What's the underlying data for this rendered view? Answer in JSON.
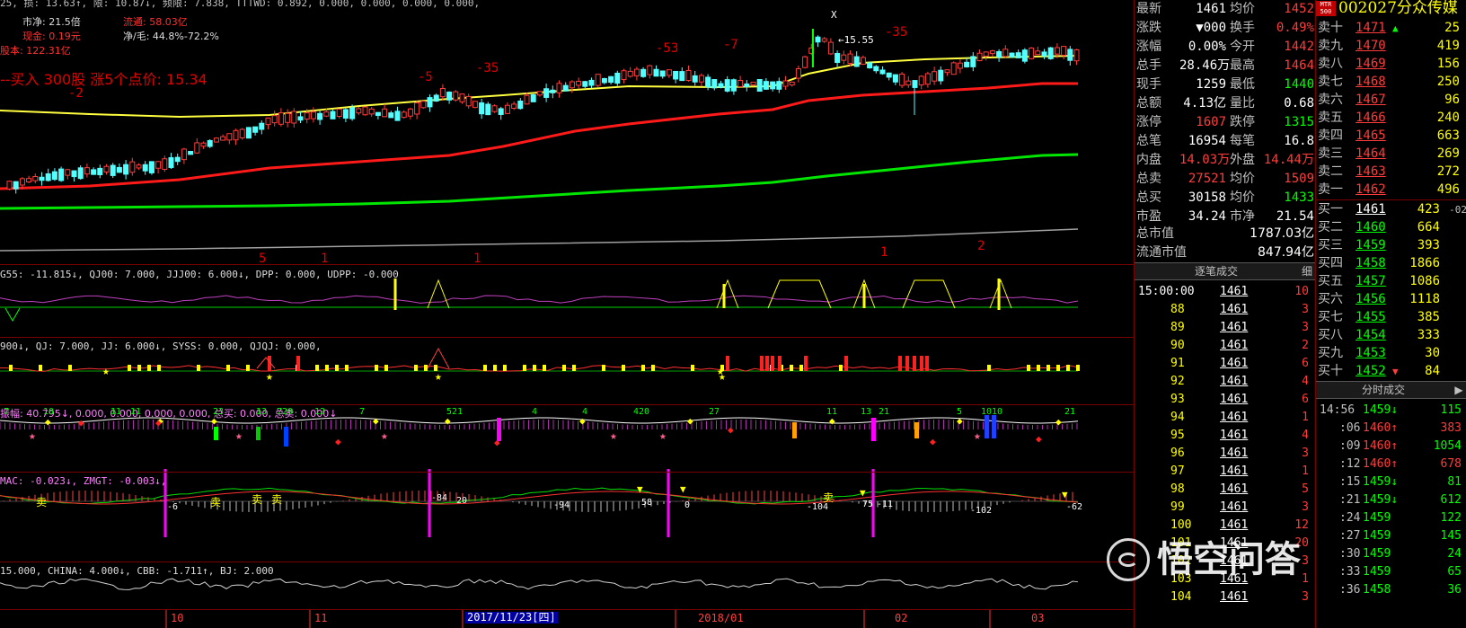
{
  "stock": {
    "code": "002027",
    "name": "分众传媒",
    "logo_text": "MTR 500"
  },
  "top_info": {
    "line1": "25, 损: 13.63↑, 限: 10.87↓, 频限: 7.838, TTTWD: 0.892, 0.000, 0.000, 0.000, 0.000,",
    "shi_jing_label": "市净:",
    "shi_jing_value": "21.5倍",
    "liutong_label": "流通:",
    "liutong_value": "58.03亿",
    "xianjin_label": "现金:",
    "xianjin_value": "0.19元",
    "jingmao_label": "净/毛:",
    "jingmao_value": "44.8%-72.2%",
    "guben_label": "股本:",
    "guben_value": "122.31亿",
    "buy_note": "--买入 300股    涨5个点价: 15.34"
  },
  "price_annotations": {
    "peak": "←15.55",
    "x_mark": "X",
    "nums_red": [
      "-2",
      "-5",
      "-35",
      "-53",
      "-7",
      "-35"
    ],
    "bottom_red": [
      "5",
      "1",
      "1",
      "1",
      "2"
    ]
  },
  "indicators": {
    "ind1": "G55: -11.815↓, QJ00: 7.000, JJJ00: 6.000↓, DPP: 0.000, UDPP: -0.000",
    "ind2": "900↓, QJ: 7.000, JJ: 6.000↓, SYSS: 0.000, QJQJ: 0.000,",
    "ind3": "振幅: 40.795↓, 0.000, 0.000, 0.000, 0.000, 总买: 0.000, 总卖: 0.000↓",
    "ind4": "MAC: -0.023↓, ZMGT: -0.003↓,",
    "ind5": "15.000, CHINA: 4.000↓, CBB: -1.711↑, BJ: 2.000"
  },
  "ind3_labels": [
    "7",
    "10",
    "11",
    "11",
    "23",
    "13",
    "720",
    "12",
    "7",
    "521",
    "4",
    "4",
    "420",
    "27",
    "11",
    "13",
    "21",
    "5",
    "1010",
    "21"
  ],
  "ind4_labels": {
    "sell": "卖",
    "vals": [
      "-6",
      "-84",
      "20",
      "-94",
      "58",
      "0",
      "-104",
      "75",
      "-11",
      "-102",
      "-62"
    ]
  },
  "time_axis": {
    "ticks": [
      "10",
      "11",
      "2017/11/23[四]",
      "2018/01",
      "02",
      "03"
    ]
  },
  "quote": {
    "rows": [
      {
        "l1": "最新",
        "v1": "1461",
        "l2": "均价",
        "v2": "1452"
      },
      {
        "l1": "涨跌",
        "v1": "▼000",
        "l2": "换手",
        "v2": "0.49%"
      },
      {
        "l1": "涨幅",
        "v1": "0.00%",
        "l2": "今开",
        "v2": "1442"
      },
      {
        "l1": "总手",
        "v1": "28.46万",
        "l2": "最高",
        "v2": "1464"
      },
      {
        "l1": "现手",
        "v1": "1259",
        "l2": "最低",
        "v2": "1440"
      },
      {
        "l1": "总额",
        "v1": "4.13亿",
        "l2": "量比",
        "v2": "0.68"
      },
      {
        "l1": "涨停",
        "v1": "1607",
        "l2": "跌停",
        "v2": "1315"
      },
      {
        "l1": "总笔",
        "v1": "16954",
        "l2": "每笔",
        "v2": "16.8"
      },
      {
        "l1": "内盘",
        "v1": "14.03万",
        "l2": "外盘",
        "v2": "14.44万"
      },
      {
        "l1": "总卖",
        "v1": "27521",
        "l2": "均价",
        "v2": "1509"
      },
      {
        "l1": "总买",
        "v1": "30158",
        "l2": "均价",
        "v2": "1433"
      },
      {
        "l1": "市盈",
        "v1": "34.24",
        "l2": "市净",
        "v2": "21.54"
      }
    ],
    "shizhi_label": "总市值",
    "shizhi_value": "1787.03亿",
    "liutong_label": "流通市值",
    "liutong_value": "847.94亿"
  },
  "tick_panel": {
    "title": "逐笔成交",
    "btn": "细",
    "rows": [
      {
        "t": "15:00:00",
        "p": "1461",
        "v": "10"
      },
      {
        "t": "88",
        "p": "1461",
        "v": "3"
      },
      {
        "t": "89",
        "p": "1461",
        "v": "3"
      },
      {
        "t": "90",
        "p": "1461",
        "v": "2"
      },
      {
        "t": "91",
        "p": "1461",
        "v": "6"
      },
      {
        "t": "92",
        "p": "1461",
        "v": "4"
      },
      {
        "t": "93",
        "p": "1461",
        "v": "6"
      },
      {
        "t": "94",
        "p": "1461",
        "v": "1"
      },
      {
        "t": "95",
        "p": "1461",
        "v": "4"
      },
      {
        "t": "96",
        "p": "1461",
        "v": "3"
      },
      {
        "t": "97",
        "p": "1461",
        "v": "1"
      },
      {
        "t": "98",
        "p": "1461",
        "v": "5"
      },
      {
        "t": "99",
        "p": "1461",
        "v": "3"
      },
      {
        "t": "100",
        "p": "1461",
        "v": "12"
      },
      {
        "t": "101",
        "p": "1461",
        "v": "20"
      },
      {
        "t": "102",
        "p": "1461",
        "v": "3"
      },
      {
        "t": "103",
        "p": "1461",
        "v": "1"
      },
      {
        "t": "104",
        "p": "1461",
        "v": "3"
      }
    ]
  },
  "orderbook": {
    "sells": [
      {
        "l": "卖十",
        "p": "1471",
        "v": "25",
        "mark": "▲"
      },
      {
        "l": "卖九",
        "p": "1470",
        "v": "419"
      },
      {
        "l": "卖八",
        "p": "1469",
        "v": "156"
      },
      {
        "l": "卖七",
        "p": "1468",
        "v": "250"
      },
      {
        "l": "卖六",
        "p": "1467",
        "v": "96"
      },
      {
        "l": "卖五",
        "p": "1466",
        "v": "240"
      },
      {
        "l": "卖四",
        "p": "1465",
        "v": "663"
      },
      {
        "l": "卖三",
        "p": "1464",
        "v": "269"
      },
      {
        "l": "卖二",
        "p": "1463",
        "v": "272"
      },
      {
        "l": "卖一",
        "p": "1462",
        "v": "496"
      }
    ],
    "buys": [
      {
        "l": "买一",
        "p": "1461",
        "v": "423",
        "extra": "-02"
      },
      {
        "l": "买二",
        "p": "1460",
        "v": "664"
      },
      {
        "l": "买三",
        "p": "1459",
        "v": "393"
      },
      {
        "l": "买四",
        "p": "1458",
        "v": "1866"
      },
      {
        "l": "买五",
        "p": "1457",
        "v": "1086"
      },
      {
        "l": "买六",
        "p": "1456",
        "v": "1118"
      },
      {
        "l": "买七",
        "p": "1455",
        "v": "385"
      },
      {
        "l": "买八",
        "p": "1454",
        "v": "333"
      },
      {
        "l": "买九",
        "p": "1453",
        "v": "30"
      },
      {
        "l": "买十",
        "p": "1452",
        "v": "84",
        "mark": "▼"
      }
    ]
  },
  "time_sales": {
    "title": "分时成交",
    "rows": [
      {
        "t": "14:56",
        "p": "1459",
        "a": "↓",
        "v": "115",
        "c": "green"
      },
      {
        "t": ":06",
        "p": "1460",
        "a": "↑",
        "v": "383",
        "c": "red"
      },
      {
        "t": ":09",
        "p": "1460",
        "a": "↑",
        "v": "1054",
        "c": "green"
      },
      {
        "t": ":12",
        "p": "1460",
        "a": "↑",
        "v": "678",
        "c": "red"
      },
      {
        "t": ":15",
        "p": "1459",
        "a": "↓",
        "v": "81",
        "c": "green"
      },
      {
        "t": ":21",
        "p": "1459",
        "a": "↓",
        "v": "612",
        "c": "green"
      },
      {
        "t": ":24",
        "p": "1459",
        "a": "",
        "v": "122",
        "c": "green"
      },
      {
        "t": ":27",
        "p": "1459",
        "a": "",
        "v": "145",
        "c": "green"
      },
      {
        "t": ":30",
        "p": "1459",
        "a": "",
        "v": "24",
        "c": "green"
      },
      {
        "t": ":33",
        "p": "1459",
        "a": "",
        "v": "65",
        "c": "green"
      },
      {
        "t": ":36",
        "p": "1458",
        "a": "",
        "v": "36",
        "c": "green"
      }
    ]
  },
  "watermark": "悟空问答",
  "colors": {
    "up": "#ff3c3c",
    "down": "#54ffff",
    "yellow": "#ffff00",
    "green": "#00ff00",
    "bg": "#000000"
  }
}
